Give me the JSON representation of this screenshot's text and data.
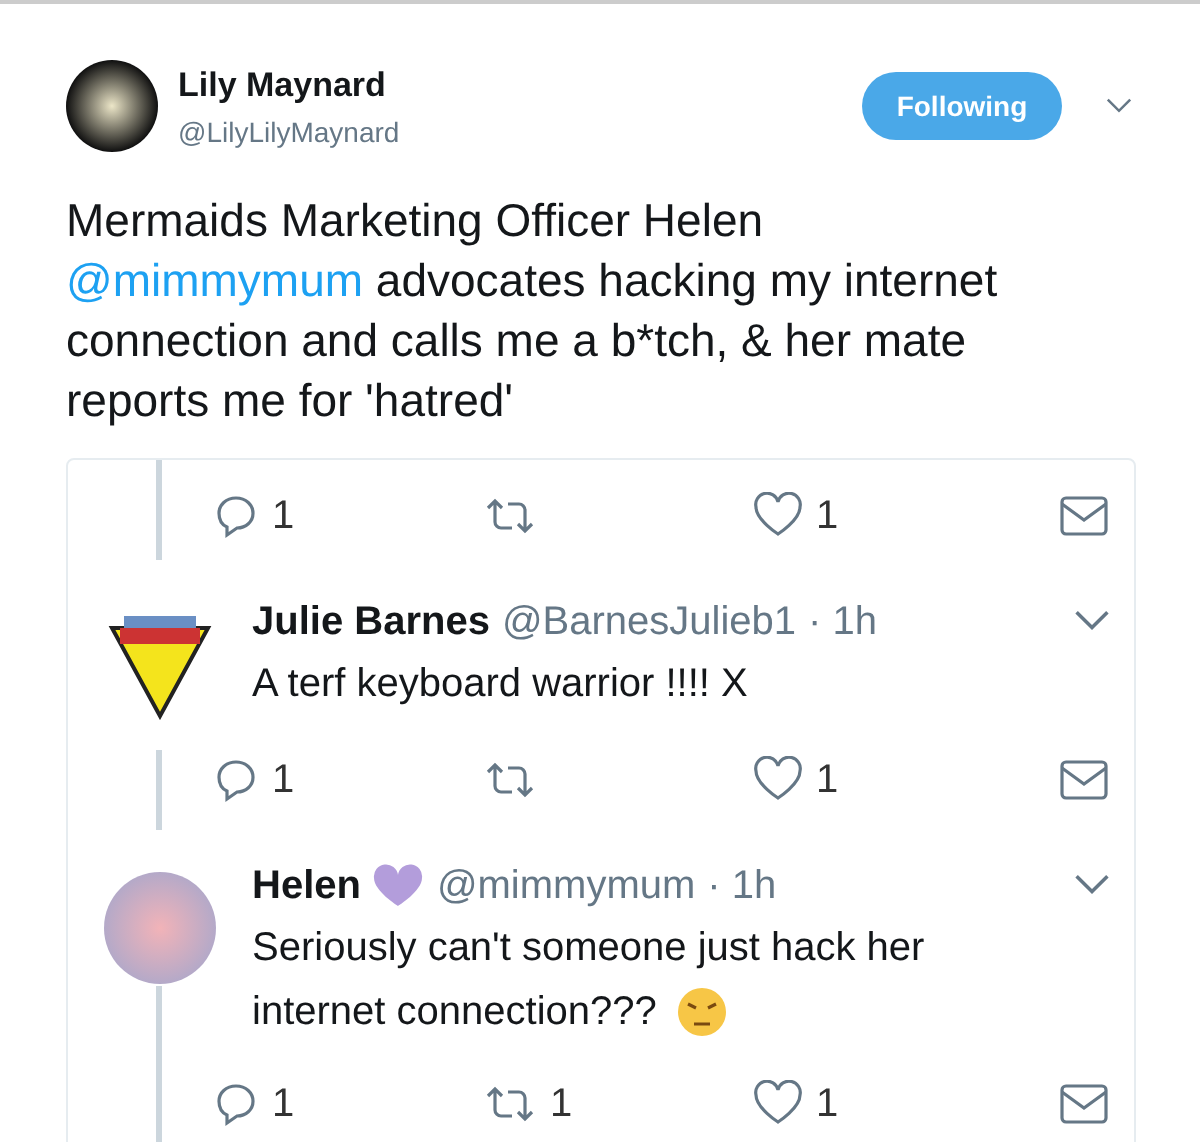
{
  "author": {
    "name": "Lily Maynard",
    "handle": "@LilyLilyMaynard"
  },
  "follow_button": {
    "label": "Following",
    "selected": true
  },
  "tweet": {
    "segments": [
      {
        "kind": "text",
        "text": "Mermaids Marketing Officer Helen "
      },
      {
        "kind": "mention",
        "text": "@mimmymum"
      },
      {
        "kind": "text",
        "text": " advocates hacking my internet connection and calls me a b*tch, & her mate reports me for 'hatred'"
      }
    ]
  },
  "embedded": {
    "items": [
      {
        "kind": "actions",
        "replies": "1",
        "likes": "1"
      },
      {
        "kind": "reply",
        "avatar": {
          "kind": "sign"
        },
        "name": "Julie Barnes",
        "handle": "@BarnesJulieb1",
        "time": "· 1h",
        "text": "A terf keyboard warrior !!!! X",
        "replies": "1",
        "likes": "1"
      },
      {
        "kind": "reply",
        "avatar": {
          "kind": "flower"
        },
        "name": "Helen",
        "heart": true,
        "handle": "@mimmymum",
        "time": "· 1h",
        "text": "Seriously can't someone just hack her internet connection???",
        "emoji": true,
        "replies": "1",
        "retweets": "1",
        "likes": "1"
      }
    ]
  }
}
